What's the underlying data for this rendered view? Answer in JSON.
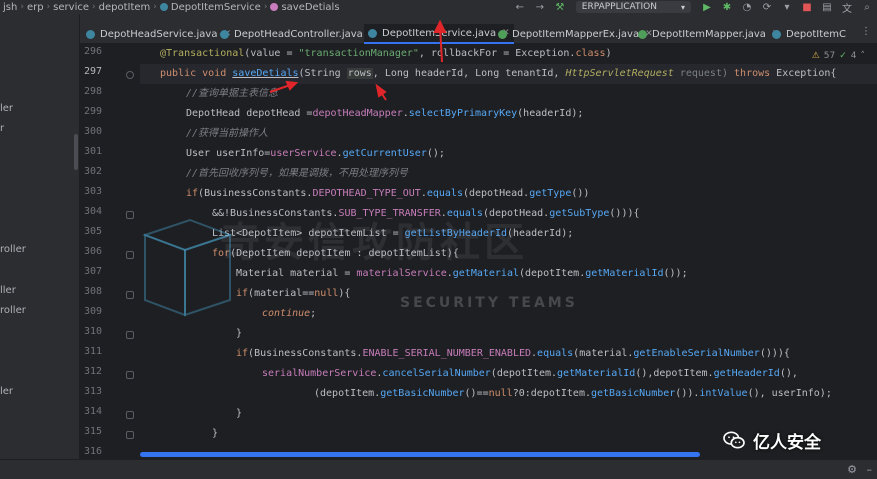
{
  "breadcrumb": [
    "jsh",
    "erp",
    "service",
    "depotItem",
    "DepotItemService",
    "saveDetials"
  ],
  "run_config": {
    "name": "ERPAPPLICATION"
  },
  "tabs": [
    {
      "label": "DepotHeadService.java",
      "type": "class",
      "active": false
    },
    {
      "label": "DepotHeadController.java",
      "type": "class",
      "active": false
    },
    {
      "label": "DepotItemService.java",
      "type": "class",
      "active": true
    },
    {
      "label": "DepotItemMapperEx.java",
      "type": "interface",
      "active": false
    },
    {
      "label": "DepotItemMapper.java",
      "type": "interface",
      "active": false
    },
    {
      "label": "DepotItemC",
      "type": "class",
      "active": false
    }
  ],
  "left_panel_items": [
    "ler",
    "r",
    "roller",
    "ller",
    "roller",
    "ler"
  ],
  "inspection": {
    "warnings": "57",
    "checks": "4"
  },
  "line_numbers": [
    "296",
    "297",
    "298",
    "299",
    "300",
    "301",
    "302",
    "303",
    "304",
    "305",
    "306",
    "307",
    "308",
    "309",
    "310",
    "311",
    "312",
    "313",
    "314",
    "315",
    "316"
  ],
  "current_line": "297",
  "code": {
    "l296": {
      "ann": "@Transactional",
      "open": "(value = ",
      "str": "\"transactionManager\"",
      "mid": ", rollbackFor = Exception.",
      "kw": "class",
      "close": ")"
    },
    "l297": {
      "kw1": "public",
      "kw2": "void",
      "method": "saveDetials",
      "p1": "(String ",
      "p1n": "rows",
      "p2": ", Long headerId, Long tenantId, ",
      "p3t": "HttpServletRequest",
      "p3n": " request) ",
      "kw3": "throws",
      "p4": " Exception{"
    },
    "l298": "//查询单据主表信息",
    "l299": {
      "t": "DepotHead depotHead =",
      "fld": "depotHeadMapper",
      "dot": ".",
      "fn": "selectByPrimaryKey",
      "rest": "(headerId);"
    },
    "l300": "//获得当前操作人",
    "l301": {
      "t": "User userInfo=",
      "fld": "userService",
      "dot": ".",
      "fn": "getCurrentUser",
      "rest": "();"
    },
    "l302": "//首先回收序列号，如果是调拨，不用处理序列号",
    "l303": {
      "kw": "if",
      "a": "(BusinessConstants.",
      "fld": "DEPOTHEAD_TYPE_OUT",
      "dot": ".",
      "fn": "equals",
      "b": "(depotHead.",
      "fn2": "getType",
      "c": "())"
    },
    "l304": {
      "a": "&&!BusinessConstants.",
      "fld": "SUB_TYPE_TRANSFER",
      "dot": ".",
      "fn": "equals",
      "b": "(depotHead.",
      "fn2": "getSubType",
      "c": "())){"
    },
    "l305": {
      "a": "List<DepotItem> depotItemList = ",
      "fn": "getListByHeaderId",
      "b": "(headerId);"
    },
    "l306": {
      "kw": "for",
      "a": "(DepotItem depotItem : depotItemList){"
    },
    "l307": {
      "a": "Material material = ",
      "fld": "materialService",
      "dot": ".",
      "fn": "getMaterial",
      "b": "(depotItem.",
      "fn2": "getMaterialId",
      "c": "());"
    },
    "l308": {
      "kw": "if",
      "a": "(material==",
      "kw2": "null",
      "b": "){"
    },
    "l309": {
      "kw": "continue",
      "a": ";"
    },
    "l310": "}",
    "l311": {
      "kw": "if",
      "a": "(BusinessConstants.",
      "fld": "ENABLE_SERIAL_NUMBER_ENABLED",
      "dot": ".",
      "fn": "equals",
      "b": "(material.",
      "fn2": "getEnableSerialNumber",
      "c": "())){"
    },
    "l312": {
      "fld": "serialNumberService",
      "dot": ".",
      "fn": "cancelSerialNumber",
      "a": "(depotItem.",
      "fn2": "getMaterialId",
      "b": "(),depotItem.",
      "fn3": "getHeaderId",
      "c": "(),"
    },
    "l313": {
      "a": "(depotItem.",
      "fn": "getBasicNumber",
      "b": "()==",
      "kw": "null",
      "c": "?0:depotItem.",
      "fn2": "getBasicNumber",
      "d": "()).",
      "fn3": "intValue",
      "e": "(), userInfo);"
    },
    "l314": "}",
    "l315": "}"
  },
  "watermark": {
    "cn": "奇安信攻防社区",
    "en": "SECURITY TEAMS"
  },
  "badge": {
    "text": "亿人安全"
  },
  "colors": {
    "keyword": "#cf8e6d",
    "annotation": "#b3ae60",
    "string": "#6aab73",
    "method": "#56a8f5",
    "field": "#c77dbb",
    "comment": "#7a7e85",
    "accent": "#3574f0",
    "arrow": "#e0262a"
  }
}
